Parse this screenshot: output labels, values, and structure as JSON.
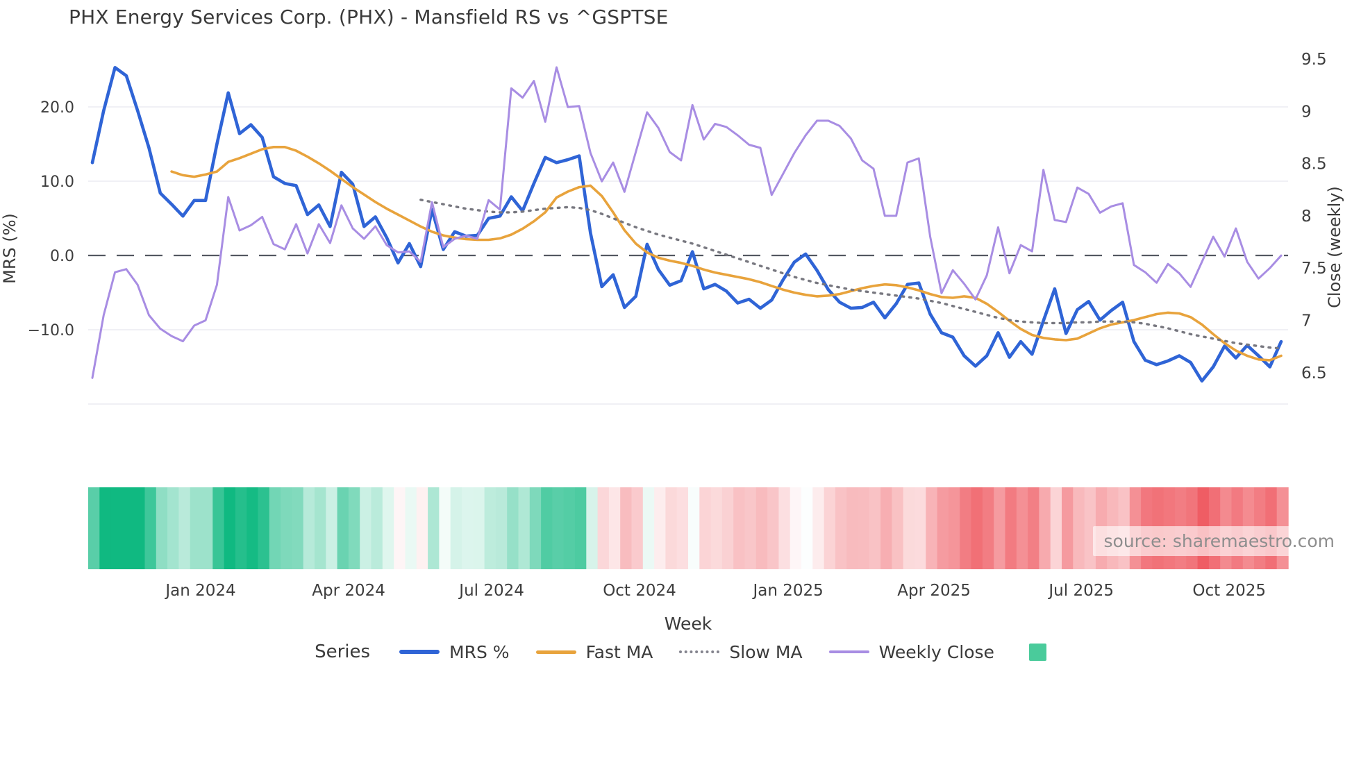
{
  "title": "PHX Energy Services Corp. (PHX) - Mansfield RS vs ^GSPTSE",
  "source_note": "source: sharemaestro.com",
  "legend": {
    "title": "Series",
    "items": [
      {
        "label": "MRS %",
        "color": "#2f64d6",
        "style": "solid"
      },
      {
        "label": "Fast MA",
        "color": "#e8a33c",
        "style": "solid"
      },
      {
        "label": "Slow MA",
        "color": "#83838d",
        "style": "dotted"
      },
      {
        "label": "Weekly Close",
        "color": "#a88de3",
        "style": "solid"
      }
    ],
    "heatmap_swatch_color": "#4acb9b"
  },
  "chart_data": {
    "type": "line",
    "title": "PHX Energy Services Corp. (PHX) - Mansfield RS vs ^GSPTSE",
    "x": {
      "label": "Week",
      "unit": "week",
      "n_points": 106,
      "range_note": "weekly data, Nov 2023 - Nov 2025",
      "ticks": [
        {
          "pos": 9.57,
          "label": "Jan 2024"
        },
        {
          "pos": 22.64,
          "label": "Apr 2024"
        },
        {
          "pos": 35.27,
          "label": "Jul 2024"
        },
        {
          "pos": 48.33,
          "label": "Oct 2024"
        },
        {
          "pos": 61.46,
          "label": "Jan 2025"
        },
        {
          "pos": 74.34,
          "label": "Apr 2025"
        },
        {
          "pos": 87.35,
          "label": "Jul 2025"
        },
        {
          "pos": 100.41,
          "label": "Oct 2025"
        }
      ]
    },
    "y_left": {
      "label": "MRS (%)",
      "tick_values": [
        20,
        10,
        0,
        -10
      ],
      "tick_labels": [
        "20.0",
        "10.0",
        "0.0",
        "−10.0"
      ],
      "gridline_values": [
        20,
        10,
        -10,
        -20
      ],
      "ylim": [
        -23.6,
        29.3
      ],
      "zero_line": {
        "value": 0,
        "style": "dashed",
        "color": "#545861"
      }
    },
    "y_right": {
      "label": "Close (weekly)",
      "tick_values": [
        9.5,
        9,
        8.5,
        8,
        7.5,
        7,
        6.5
      ],
      "tick_labels": [
        "9.5",
        "9",
        "8.5",
        "8",
        "7.5",
        "7",
        "6.5"
      ],
      "ylim": [
        5.95,
        9.72
      ]
    },
    "series": [
      {
        "name": "MRS %",
        "axis": "left",
        "color": "#2f64d6",
        "style": "solid",
        "width": 4.6,
        "values": [
          12.5,
          19.5,
          25.3,
          24.2,
          19.5,
          14.5,
          8.4,
          6.9,
          5.3,
          7.4,
          7.4,
          15.0,
          21.9,
          16.4,
          17.6,
          15.9,
          10.6,
          9.7,
          9.4,
          5.5,
          6.8,
          3.9,
          11.2,
          9.6,
          3.9,
          5.2,
          2.4,
          -1.0,
          1.6,
          -1.5,
          6.2,
          0.8,
          3.2,
          2.6,
          2.7,
          5.0,
          5.3,
          7.9,
          6.0,
          9.7,
          13.2,
          12.5,
          12.9,
          13.4,
          3.0,
          -4.2,
          -2.6,
          -7.0,
          -5.5,
          1.5,
          -1.9,
          -4.0,
          -3.4,
          0.5,
          -4.5,
          -3.9,
          -4.8,
          -6.4,
          -5.9,
          -7.1,
          -6.0,
          -3.3,
          -0.9,
          0.2,
          -2.0,
          -4.6,
          -6.3,
          -7.1,
          -7.0,
          -6.3,
          -8.4,
          -6.5,
          -3.9,
          -3.7,
          -7.9,
          -10.4,
          -11.0,
          -13.5,
          -14.9,
          -13.5,
          -10.4,
          -13.7,
          -11.6,
          -13.3,
          -8.8,
          -4.5,
          -10.5,
          -7.3,
          -6.2,
          -8.7,
          -7.4,
          -6.3,
          -11.6,
          -14.1,
          -14.7,
          -14.2,
          -13.5,
          -14.4,
          -16.9,
          -15.0,
          -12.2,
          -13.8,
          -12.1,
          -13.5,
          -15.0,
          -11.6
        ]
      },
      {
        "name": "Fast MA",
        "axis": "left",
        "color": "#e8a33c",
        "style": "solid",
        "width": 3.6,
        "values": [
          null,
          null,
          null,
          null,
          null,
          null,
          null,
          11.3,
          10.8,
          10.6,
          10.9,
          11.3,
          12.6,
          13.1,
          13.7,
          14.3,
          14.6,
          14.6,
          14.1,
          13.3,
          12.4,
          11.4,
          10.3,
          9.2,
          8.2,
          7.2,
          6.3,
          5.5,
          4.7,
          3.9,
          3.2,
          2.7,
          2.4,
          2.2,
          2.1,
          2.1,
          2.3,
          2.8,
          3.6,
          4.6,
          5.8,
          7.8,
          8.6,
          9.2,
          9.4,
          8.0,
          5.8,
          3.4,
          1.6,
          0.4,
          -0.3,
          -0.7,
          -1.0,
          -1.4,
          -1.9,
          -2.3,
          -2.6,
          -2.9,
          -3.2,
          -3.6,
          -4.1,
          -4.6,
          -5.0,
          -5.3,
          -5.5,
          -5.4,
          -5.2,
          -4.8,
          -4.4,
          -4.1,
          -3.9,
          -4.0,
          -4.3,
          -4.7,
          -5.2,
          -5.6,
          -5.7,
          -5.5,
          -5.7,
          -6.5,
          -7.6,
          -8.8,
          -9.9,
          -10.7,
          -11.1,
          -11.3,
          -11.4,
          -11.2,
          -10.5,
          -9.8,
          -9.3,
          -9.0,
          -8.7,
          -8.3,
          -7.9,
          -7.7,
          -7.8,
          -8.3,
          -9.3,
          -10.6,
          -11.8,
          -12.8,
          -13.5,
          -14.0,
          -14.1,
          -13.5
        ]
      },
      {
        "name": "Slow MA",
        "axis": "left",
        "color": "#77777f",
        "style": "dotted",
        "width": 3.4,
        "values": [
          null,
          null,
          null,
          null,
          null,
          null,
          null,
          null,
          null,
          null,
          null,
          null,
          null,
          null,
          null,
          null,
          null,
          null,
          null,
          null,
          null,
          null,
          null,
          null,
          null,
          null,
          null,
          null,
          null,
          7.5,
          7.2,
          6.9,
          6.6,
          6.3,
          6.1,
          5.9,
          5.8,
          5.8,
          5.9,
          6.1,
          6.3,
          6.4,
          6.5,
          6.4,
          6.1,
          5.6,
          5.0,
          4.4,
          3.8,
          3.3,
          2.8,
          2.4,
          2.0,
          1.6,
          1.1,
          0.6,
          0.1,
          -0.4,
          -0.9,
          -1.4,
          -1.9,
          -2.4,
          -2.9,
          -3.3,
          -3.7,
          -4.0,
          -4.3,
          -4.6,
          -4.8,
          -5.0,
          -5.2,
          -5.4,
          -5.6,
          -5.8,
          -6.1,
          -6.4,
          -6.8,
          -7.2,
          -7.6,
          -8.0,
          -8.4,
          -8.7,
          -8.9,
          -9.0,
          -9.1,
          -9.1,
          -9.1,
          -9.0,
          -9.0,
          -8.9,
          -8.9,
          -8.9,
          -9.0,
          -9.2,
          -9.5,
          -9.8,
          -10.2,
          -10.6,
          -10.9,
          -11.2,
          -11.5,
          -11.8,
          -12.0,
          -12.2,
          -12.4,
          -12.5
        ]
      },
      {
        "name": "Weekly Close",
        "axis": "right",
        "color": "#a88de3",
        "style": "solid",
        "width": 3.0,
        "values": [
          6.45,
          7.05,
          7.46,
          7.49,
          7.34,
          7.05,
          6.92,
          6.85,
          6.8,
          6.95,
          7.0,
          7.34,
          8.18,
          7.86,
          7.91,
          7.99,
          7.73,
          7.68,
          7.92,
          7.64,
          7.92,
          7.74,
          8.1,
          7.88,
          7.78,
          7.9,
          7.72,
          7.65,
          7.66,
          7.56,
          8.13,
          7.7,
          7.78,
          7.81,
          7.78,
          8.15,
          8.06,
          9.22,
          9.13,
          9.29,
          8.9,
          9.42,
          9.04,
          9.05,
          8.6,
          8.33,
          8.51,
          8.23,
          8.61,
          8.99,
          8.84,
          8.61,
          8.53,
          9.06,
          8.73,
          8.88,
          8.85,
          8.77,
          8.68,
          8.65,
          8.2,
          8.4,
          8.6,
          8.77,
          8.91,
          8.91,
          8.86,
          8.74,
          8.53,
          8.45,
          8.0,
          8.0,
          8.51,
          8.55,
          7.8,
          7.26,
          7.48,
          7.35,
          7.2,
          7.43,
          7.89,
          7.45,
          7.72,
          7.66,
          8.44,
          7.96,
          7.94,
          8.27,
          8.21,
          8.03,
          8.09,
          8.12,
          7.53,
          7.46,
          7.36,
          7.54,
          7.45,
          7.32,
          7.56,
          7.8,
          7.61,
          7.88,
          7.56,
          7.4,
          7.5,
          7.62
        ]
      }
    ],
    "heatmap_strip": {
      "description": "one bar per week, green when MRS % >= 0, red when < 0, intensity proportional to |MRS %|",
      "basis_series": "MRS %",
      "positive_color": "#10b981",
      "negative_color": "#ee525a",
      "full_intensity_abs_value": 18
    },
    "legend_position": "bottom",
    "grid": true
  }
}
